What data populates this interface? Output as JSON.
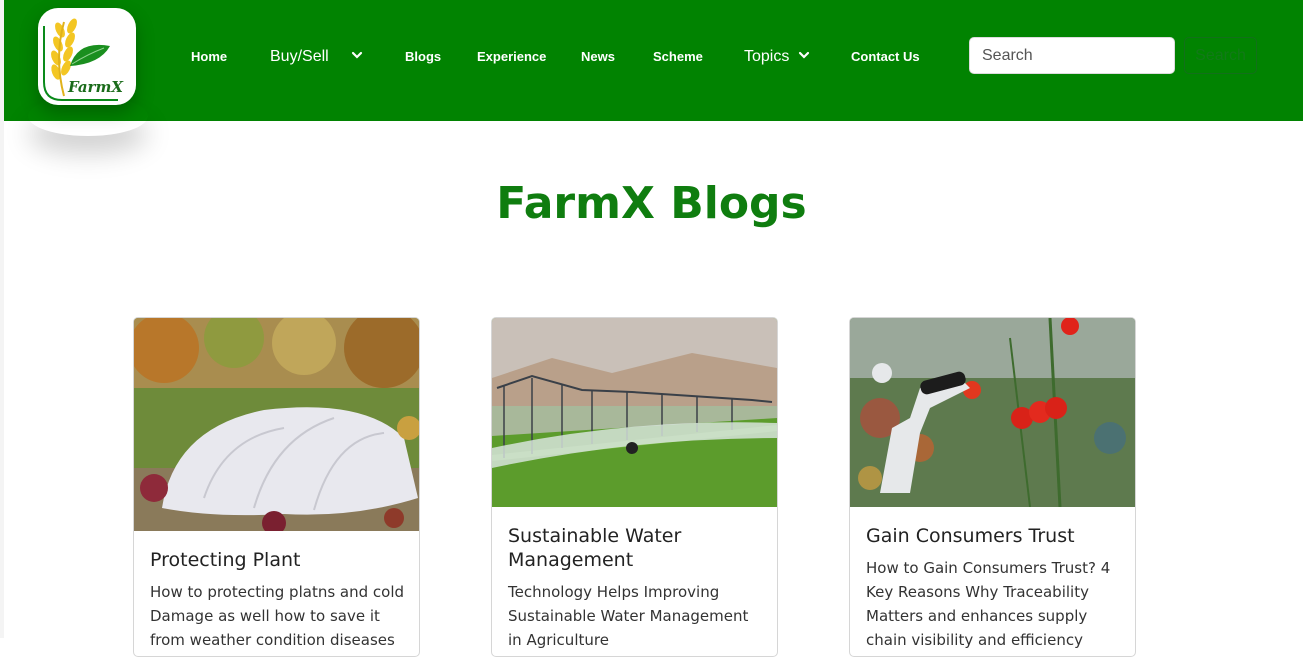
{
  "brand": {
    "logo_text": "FarmX",
    "color": "#018301"
  },
  "nav": {
    "items": [
      {
        "label": "Home"
      },
      {
        "label": "Buy/Sell"
      },
      {
        "label": "Blogs"
      },
      {
        "label": "Experience"
      },
      {
        "label": "News"
      },
      {
        "label": "Scheme"
      },
      {
        "label": "Topics"
      },
      {
        "label": "Contact Us"
      }
    ],
    "dropdown_icon": "chevron-down-icon"
  },
  "search": {
    "placeholder": "Search",
    "value": "",
    "button_label": "Search"
  },
  "page": {
    "title": "FarmX Blogs",
    "title_color": "#0f7d0f"
  },
  "cards": [
    {
      "title": "Protecting Plant",
      "text": "How to protecting platns and cold Damage as well how to save it from weather condition diseases",
      "image": "plant-cover-photo"
    },
    {
      "title": "Sustainable Water Management",
      "text": "Technology Helps Improving Sustainable Water Management in Agriculture",
      "image": "irrigation-photo"
    },
    {
      "title": "Gain Consumers Trust",
      "text": "How to Gain Consumers Trust? 4 Key Reasons Why Traceability Matters and enhances supply chain visibility and efficiency",
      "image": "robot-tomato-photo"
    }
  ]
}
